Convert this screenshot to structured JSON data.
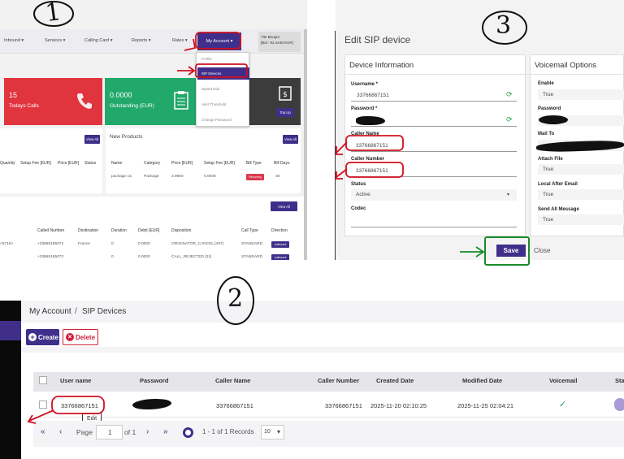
{
  "panel1": {
    "nav": [
      "Inbound ▾",
      "Services ▾",
      "Calling Card ▾",
      "Reports ▾",
      "Rates ▾"
    ],
    "my_account": "My Account ▾",
    "account_name": "Tite Beugre",
    "account_balance": "[Bal : 92.4448 EUR]",
    "dropdown": [
      "Profile",
      "SIP Devices",
      "Speed Dial",
      "Alert Threshold",
      "Change Password"
    ],
    "cards": {
      "red_value": "15",
      "red_label": "Todays Calls",
      "green_value": "0.0000",
      "green_label": "Outstanding (EUR)",
      "topup": "Top Up"
    },
    "left_table": {
      "headers": [
        "Quantity",
        "Setup Fee [EUR]",
        "Price [EUR]",
        "Status"
      ]
    },
    "view_all": "View All",
    "new_products": {
      "title": "New Products",
      "headers": [
        "Name",
        "Category",
        "Price [EUR]",
        "Setup Fee [EUR]",
        "Bill Type",
        "Bill Days"
      ],
      "row": [
        "package civ",
        "Package",
        "3.9900",
        "0.0000",
        "Recurring",
        "30"
      ]
    },
    "cdr": {
      "headers": [
        "Called Number",
        "Destination",
        "Duration",
        "Debit [EUR]",
        "Disposition",
        "Call Type",
        "Direction"
      ],
      "row1": [
        "<6715>",
        "+33665185072",
        "France",
        "0",
        "0.0000",
        "ORIGINATOR_CANCEL [487]",
        "STANDARD",
        "outbound"
      ],
      "row2": [
        "",
        "+33665185072",
        "",
        "0",
        "0.0000",
        "CALL_REJECTED [21]",
        "STANDARD",
        "outbound"
      ]
    },
    "annotation": "1"
  },
  "panel3": {
    "title": "Edit SIP device",
    "device_section": "Device Information",
    "username_label": "Username *",
    "username_value": "33766867151",
    "password_label": "Password *",
    "caller_name_label": "Caller Name",
    "caller_name_value": "33766867151",
    "caller_number_label": "Caller Number",
    "caller_number_value": "33766867151",
    "status_label": "Status",
    "status_value": "Active",
    "codec_label": "Codec",
    "voicemail_section": "Voicemail Options",
    "enable_label": "Enable",
    "enable_value": "True",
    "vm_password_label": "Password",
    "mailto_label": "Mail To",
    "attach_label": "Attach File",
    "attach_value": "True",
    "local_label": "Local After Email",
    "local_value": "True",
    "sendall_label": "Send All Message",
    "sendall_value": "True",
    "save": "Save",
    "close": "Close",
    "annotation": "3"
  },
  "panel2": {
    "breadcrumb_root": "My Account",
    "breadcrumb_sep": "/",
    "breadcrumb_current": "SIP Devices",
    "create": "Create",
    "delete": "Delete",
    "headers": [
      "User name",
      "Password",
      "Caller Name",
      "Caller Number",
      "Created Date",
      "Modified Date",
      "Voicemail",
      "Sta"
    ],
    "row": {
      "username": "33766867151",
      "caller_name": "33766867151",
      "caller_number": "33766867151",
      "created": "2025-11-20 02:10:25",
      "modified": "2025-11-25 02:04:21",
      "voicemail": "✓"
    },
    "tooltip": "Edit",
    "pager": {
      "page_label": "Page",
      "page_value": "1",
      "of": "of 1",
      "records": "1 - 1 of 1 Records",
      "per_page": "10"
    },
    "annotation": "2"
  },
  "colors": {
    "primary": "#3f2f8a",
    "red": "#e0343f",
    "green": "#22a86a",
    "annotation_red": "#d01020",
    "annotation_green": "#1a8a2a"
  }
}
